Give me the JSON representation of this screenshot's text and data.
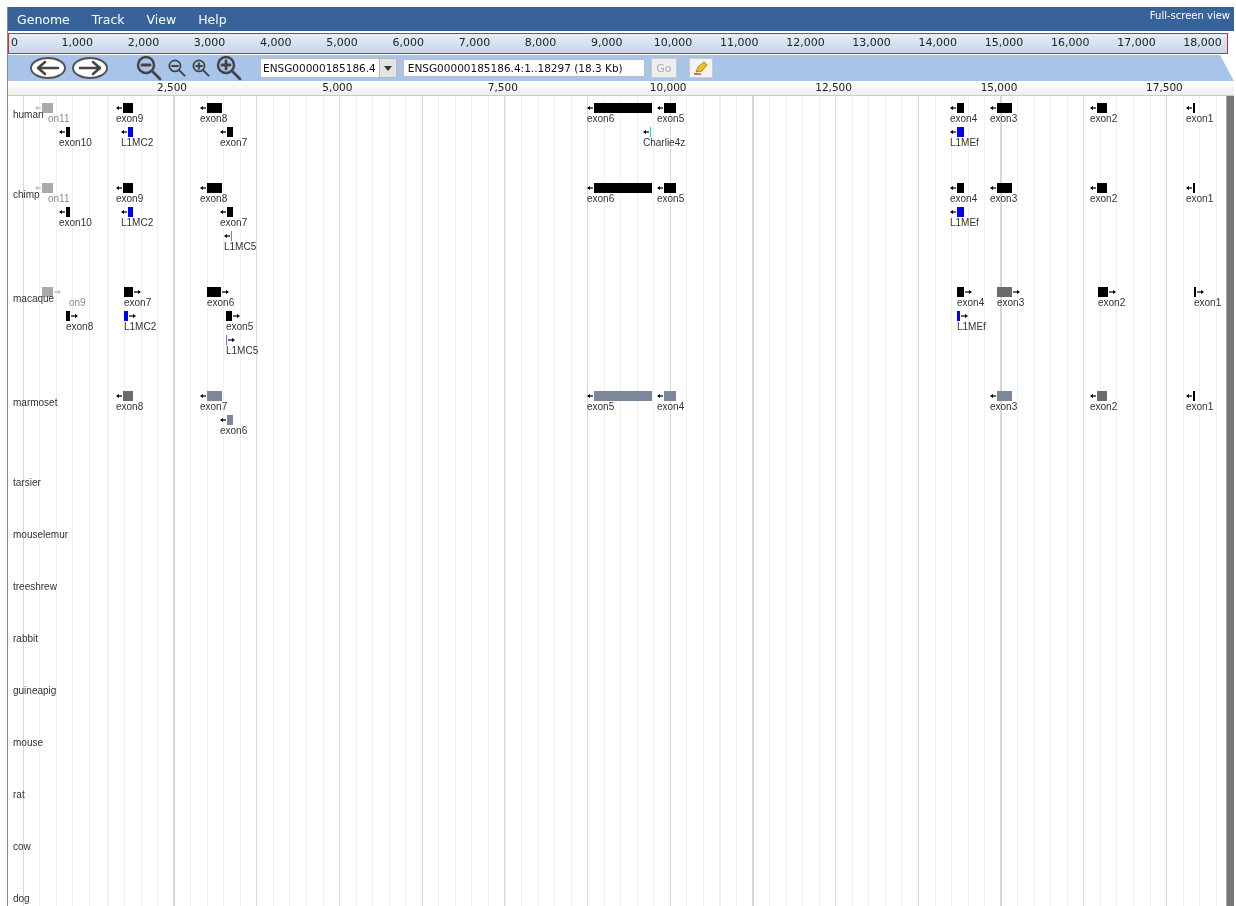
{
  "menu": {
    "items": [
      "Genome",
      "Track",
      "View",
      "Help"
    ],
    "fullscreen_link": "Full-screen view"
  },
  "overview": {
    "ticks": [
      "0",
      "1,000",
      "2,000",
      "3,000",
      "4,000",
      "5,000",
      "6,000",
      "7,000",
      "8,000",
      "9,000",
      "10,000",
      "11,000",
      "12,000",
      "13,000",
      "14,000",
      "15,000",
      "16,000",
      "17,000",
      "18,000"
    ]
  },
  "nav": {
    "reference": "ENSG00000185186.4",
    "location": "ENSG00000185186.4:1..18297 (18.3 Kb)",
    "go_button": "Go",
    "go_disabled": true
  },
  "ruler": {
    "ticks": [
      "2,500",
      "5,000",
      "7,500",
      "10,000",
      "12,500",
      "15,000",
      "17,500"
    ]
  },
  "tracks": [
    {
      "name": "human",
      "features": [
        {
          "label": "on11",
          "reverse": true,
          "color": "#aaaaaa",
          "faded": true
        },
        {
          "label": "exon9",
          "reverse": true,
          "color": "#000000",
          "faded": false
        },
        {
          "label": "exon8",
          "reverse": true,
          "color": "#000000",
          "faded": false
        },
        {
          "label": "exon6",
          "reverse": true,
          "color": "#000000",
          "faded": false
        },
        {
          "label": "exon5",
          "reverse": true,
          "color": "#000000",
          "faded": false
        },
        {
          "label": "exon4",
          "reverse": true,
          "color": "#000000",
          "faded": false
        },
        {
          "label": "exon3",
          "reverse": true,
          "color": "#000000",
          "faded": false
        },
        {
          "label": "exon2",
          "reverse": true,
          "color": "#000000",
          "faded": false
        },
        {
          "label": "exon1",
          "reverse": true,
          "color": "#000000",
          "faded": false
        },
        {
          "label": "exon10",
          "reverse": true,
          "color": "#000000",
          "faded": false
        },
        {
          "label": "L1MC2",
          "reverse": true,
          "color": "#0000ff",
          "faded": false
        },
        {
          "label": "exon7",
          "reverse": true,
          "color": "#000000",
          "faded": false
        },
        {
          "label": "Charlie4z",
          "reverse": true,
          "color": "#00e0e0",
          "faded": false
        },
        {
          "label": "L1MEf",
          "reverse": true,
          "color": "#0000ff",
          "faded": false
        }
      ]
    },
    {
      "name": "chimp",
      "features": [
        {
          "label": "on11",
          "reverse": true,
          "color": "#aaaaaa",
          "faded": true
        },
        {
          "label": "exon9",
          "reverse": true,
          "color": "#000000",
          "faded": false
        },
        {
          "label": "exon8",
          "reverse": true,
          "color": "#000000",
          "faded": false
        },
        {
          "label": "exon6",
          "reverse": true,
          "color": "#000000",
          "faded": false
        },
        {
          "label": "exon5",
          "reverse": true,
          "color": "#000000",
          "faded": false
        },
        {
          "label": "exon4",
          "reverse": true,
          "color": "#000000",
          "faded": false
        },
        {
          "label": "exon3",
          "reverse": true,
          "color": "#000000",
          "faded": false
        },
        {
          "label": "exon2",
          "reverse": true,
          "color": "#000000",
          "faded": false
        },
        {
          "label": "exon1",
          "reverse": true,
          "color": "#000000",
          "faded": false
        },
        {
          "label": "exon10",
          "reverse": true,
          "color": "#000000",
          "faded": false
        },
        {
          "label": "L1MC2",
          "reverse": true,
          "color": "#0000ff",
          "faded": false
        },
        {
          "label": "exon7",
          "reverse": true,
          "color": "#000000",
          "faded": false
        },
        {
          "label": "L1MEf",
          "reverse": true,
          "color": "#0000ff",
          "faded": false
        },
        {
          "label": "L1MC5",
          "reverse": true,
          "color": "#6f6fff",
          "faded": false
        }
      ]
    },
    {
      "name": "macaque",
      "features": [
        {
          "label": "on9",
          "reverse": false,
          "color": "#aaaaaa",
          "faded": true
        },
        {
          "label": "exon7",
          "reverse": false,
          "color": "#000000",
          "faded": false
        },
        {
          "label": "exon6",
          "reverse": false,
          "color": "#000000",
          "faded": false
        },
        {
          "label": "exon4",
          "reverse": false,
          "color": "#000000",
          "faded": false
        },
        {
          "label": "exon3",
          "reverse": false,
          "color": "#6b6b6b",
          "faded": false
        },
        {
          "label": "exon2",
          "reverse": false,
          "color": "#000000",
          "faded": false
        },
        {
          "label": "exon1",
          "reverse": false,
          "color": "#000000",
          "faded": false
        },
        {
          "label": "exon8",
          "reverse": false,
          "color": "#000000",
          "faded": false
        },
        {
          "label": "L1MC2",
          "reverse": false,
          "color": "#0000ff",
          "faded": false
        },
        {
          "label": "exon5",
          "reverse": false,
          "color": "#000000",
          "faded": false
        },
        {
          "label": "L1MEf",
          "reverse": false,
          "color": "#0000ff",
          "faded": false
        },
        {
          "label": "L1MC5",
          "reverse": false,
          "color": "#6f6fff",
          "faded": false
        }
      ]
    },
    {
      "name": "marmoset",
      "features": [
        {
          "label": "exon8",
          "reverse": true,
          "color": "#6b6b6b",
          "faded": false
        },
        {
          "label": "exon7",
          "reverse": true,
          "color": "#7a8899",
          "faded": false
        },
        {
          "label": "exon5",
          "reverse": true,
          "color": "#7a8899",
          "faded": false
        },
        {
          "label": "exon4",
          "reverse": true,
          "color": "#7a8899",
          "faded": false
        },
        {
          "label": "exon3",
          "reverse": true,
          "color": "#7a8899",
          "faded": false
        },
        {
          "label": "exon2",
          "reverse": true,
          "color": "#6b6b6b",
          "faded": false
        },
        {
          "label": "exon1",
          "reverse": true,
          "color": "#000000",
          "faded": false
        },
        {
          "label": "exon6",
          "reverse": true,
          "color": "#7a8899",
          "faded": false
        }
      ]
    },
    {
      "name": "tarsier"
    },
    {
      "name": "mouselemur"
    },
    {
      "name": "treeshrew"
    },
    {
      "name": "rabbit"
    },
    {
      "name": "guineapig"
    },
    {
      "name": "mouse"
    },
    {
      "name": "rat"
    },
    {
      "name": "cow"
    },
    {
      "name": "dog"
    }
  ]
}
